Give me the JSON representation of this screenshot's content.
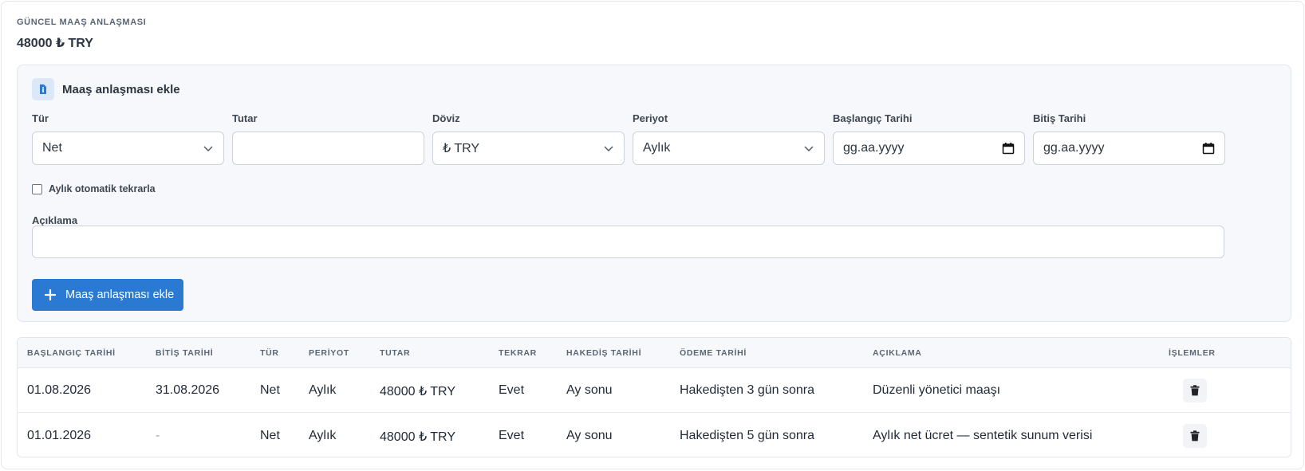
{
  "current": {
    "label": "GÜNCEL MAAŞ ANLAŞMASI",
    "value": "48000 ₺ TRY"
  },
  "form": {
    "title": "Maaş anlaşması ekle",
    "fields": {
      "type": {
        "label": "Tür",
        "value": "Net"
      },
      "amount": {
        "label": "Tutar",
        "value": ""
      },
      "currency": {
        "label": "Döviz",
        "value": "₺ TRY"
      },
      "period": {
        "label": "Periyot",
        "value": "Aylık"
      },
      "start": {
        "label": "Başlangıç Tarihi",
        "placeholder": "gg.aa.yyyy"
      },
      "end": {
        "label": "Bitiş Tarihi",
        "placeholder": "gg.aa.yyyy"
      }
    },
    "repeat_label": "Aylık otomatik tekrarla",
    "repeat_checked": false,
    "description": {
      "label": "Açıklama",
      "value": ""
    },
    "submit_label": "Maaş anlaşması ekle"
  },
  "table": {
    "headers": [
      "BAŞLANGIÇ TARİHİ",
      "BİTİŞ TARİHİ",
      "TÜR",
      "PERİYOT",
      "TUTAR",
      "TEKRAR",
      "HAKEDİŞ TARİHİ",
      "ÖDEME TARİHİ",
      "AÇIKLAMA",
      "İŞLEMLER"
    ],
    "rows": [
      [
        "01.08.2026",
        "31.08.2026",
        "Net",
        "Aylık",
        "48000 ₺ TRY",
        "Evet",
        "Ay sonu",
        "Hakedişten 3 gün sonra",
        "Düzenli yönetici maaşı"
      ],
      [
        "01.01.2026",
        "-",
        "Net",
        "Aylık",
        "48000 ₺ TRY",
        "Evet",
        "Ay sonu",
        "Hakedişten 5 gün sonra",
        "Aylık net ücret — sentetik sunum verisi"
      ]
    ]
  },
  "icons": {
    "panel": "document-icon",
    "chevron": "chevron-down-icon",
    "calendar": "calendar-icon",
    "plus": "plus-icon",
    "delete": "trash-icon"
  },
  "colors": {
    "primary": "#2a7ad4",
    "panel_bg": "#f6f8fb",
    "border": "#ccd3dc"
  }
}
